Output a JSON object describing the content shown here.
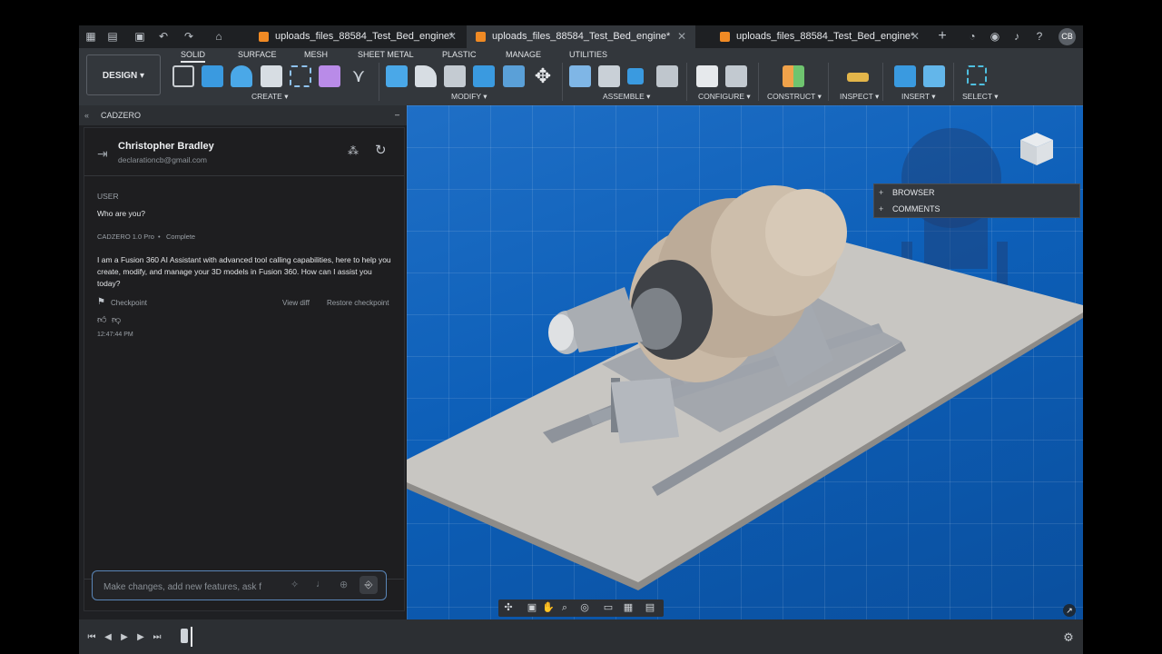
{
  "tabs": [
    {
      "label": "uploads_files_88584_Test_Bed_engine*",
      "active": false
    },
    {
      "label": "uploads_files_88584_Test_Bed_engine*",
      "active": true
    },
    {
      "label": "uploads_files_88584_Test_Bed_engine*",
      "active": false
    }
  ],
  "user_initials": "CB",
  "design_button": "DESIGN ▾",
  "workspace_tabs": [
    "SOLID",
    "SURFACE",
    "MESH",
    "SHEET METAL",
    "PLASTIC",
    "MANAGE",
    "UTILITIES"
  ],
  "tool_groups": [
    "CREATE ▾",
    "MODIFY ▾",
    "ASSEMBLE ▾",
    "CONFIGURE ▾",
    "CONSTRUCT ▾",
    "INSPECT ▾",
    "INSERT ▾",
    "SELECT ▾"
  ],
  "panel": {
    "title": "CADZERO",
    "user_name": "Christopher Bradley",
    "user_email": "declarationcb@gmail.com",
    "role_label": "USER",
    "user_message": "Who are you?",
    "model_label": "CADZERO 1.0 Pro",
    "status": "Complete",
    "reply": "I am a Fusion 360 AI Assistant with advanced tool calling capabilities, here to help you create, modify, and manage your 3D models in Fusion 360. How can I assist you today?",
    "checkpoint": "Checkpoint",
    "view_diff": "View diff",
    "restore": "Restore checkpoint",
    "timestamp": "12:47:44 PM",
    "input_placeholder": "Make changes, add new features, ask f"
  },
  "browser_panel": {
    "browser": "BROWSER",
    "comments": "COMMENTS"
  },
  "colors": {
    "accent": "#1f6fc6",
    "orange": "#f08a24"
  }
}
